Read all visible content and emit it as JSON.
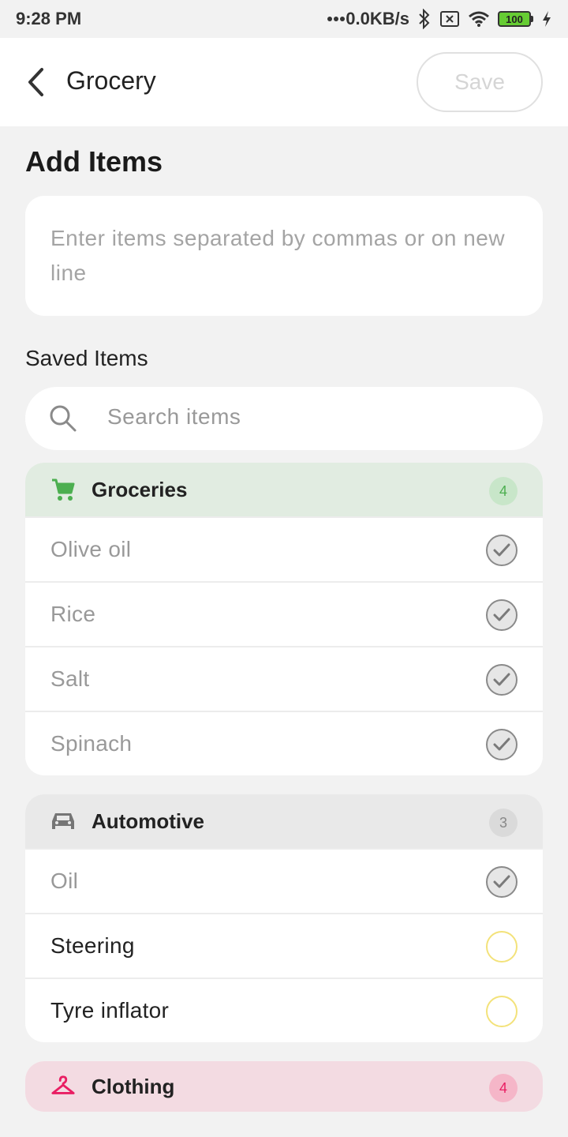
{
  "status": {
    "time": "9:28 PM",
    "network_speed": "0.0KB/s",
    "battery": "100",
    "icons": [
      "dots-icon",
      "bluetooth-icon",
      "sim-x-icon",
      "wifi-icon",
      "battery-icon",
      "charging-icon"
    ]
  },
  "appbar": {
    "title": "Grocery",
    "save_label": "Save",
    "back_icon": "chevron-left-icon"
  },
  "add_items": {
    "title": "Add Items",
    "placeholder": "Enter items separated by commas or on new line"
  },
  "saved": {
    "title": "Saved Items",
    "search_placeholder": "Search items"
  },
  "groups": [
    {
      "name": "Groceries",
      "count": "4",
      "icon": "cart-icon",
      "color": "#4caf50",
      "items": [
        {
          "label": "Olive oil",
          "checked": true
        },
        {
          "label": "Rice",
          "checked": true
        },
        {
          "label": "Salt",
          "checked": true
        },
        {
          "label": "Spinach",
          "checked": true
        }
      ]
    },
    {
      "name": "Automotive",
      "count": "3",
      "icon": "car-icon",
      "color": "#757575",
      "items": [
        {
          "label": "Oil",
          "checked": true
        },
        {
          "label": "Steering",
          "checked": false
        },
        {
          "label": "Tyre inflator",
          "checked": false
        }
      ]
    },
    {
      "name": "Clothing",
      "count": "4",
      "icon": "hanger-icon",
      "color": "#e91e63",
      "items": []
    }
  ]
}
